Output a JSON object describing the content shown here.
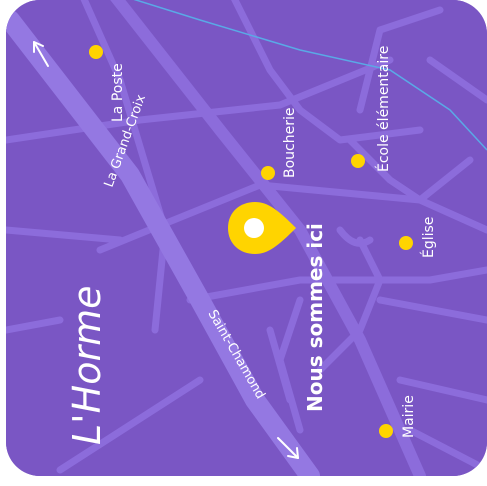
{
  "map": {
    "town_name": "L'Horme",
    "here_label": "Nous sommes ici",
    "roads": {
      "top_left": "La Grand-Croix",
      "bottom_right": "Saint-Chamond"
    },
    "places": [
      {
        "name": "La Poste"
      },
      {
        "name": "Boucherie"
      },
      {
        "name": "École élémentaire"
      },
      {
        "name": "Église"
      },
      {
        "name": "Mairie"
      }
    ],
    "colors": {
      "background": "#7a56c4",
      "road": "#8c6cdb",
      "road_main": "#9478e2",
      "river": "#5aa9e6",
      "marker": "#ffd400",
      "pin": "#ffd400",
      "pin_dot": "#ffffff",
      "text": "#ffffff"
    },
    "icons": {
      "pin": "location-pin-icon",
      "poi": "poi-dot-icon",
      "direction": "direction-arrow-icon"
    }
  }
}
